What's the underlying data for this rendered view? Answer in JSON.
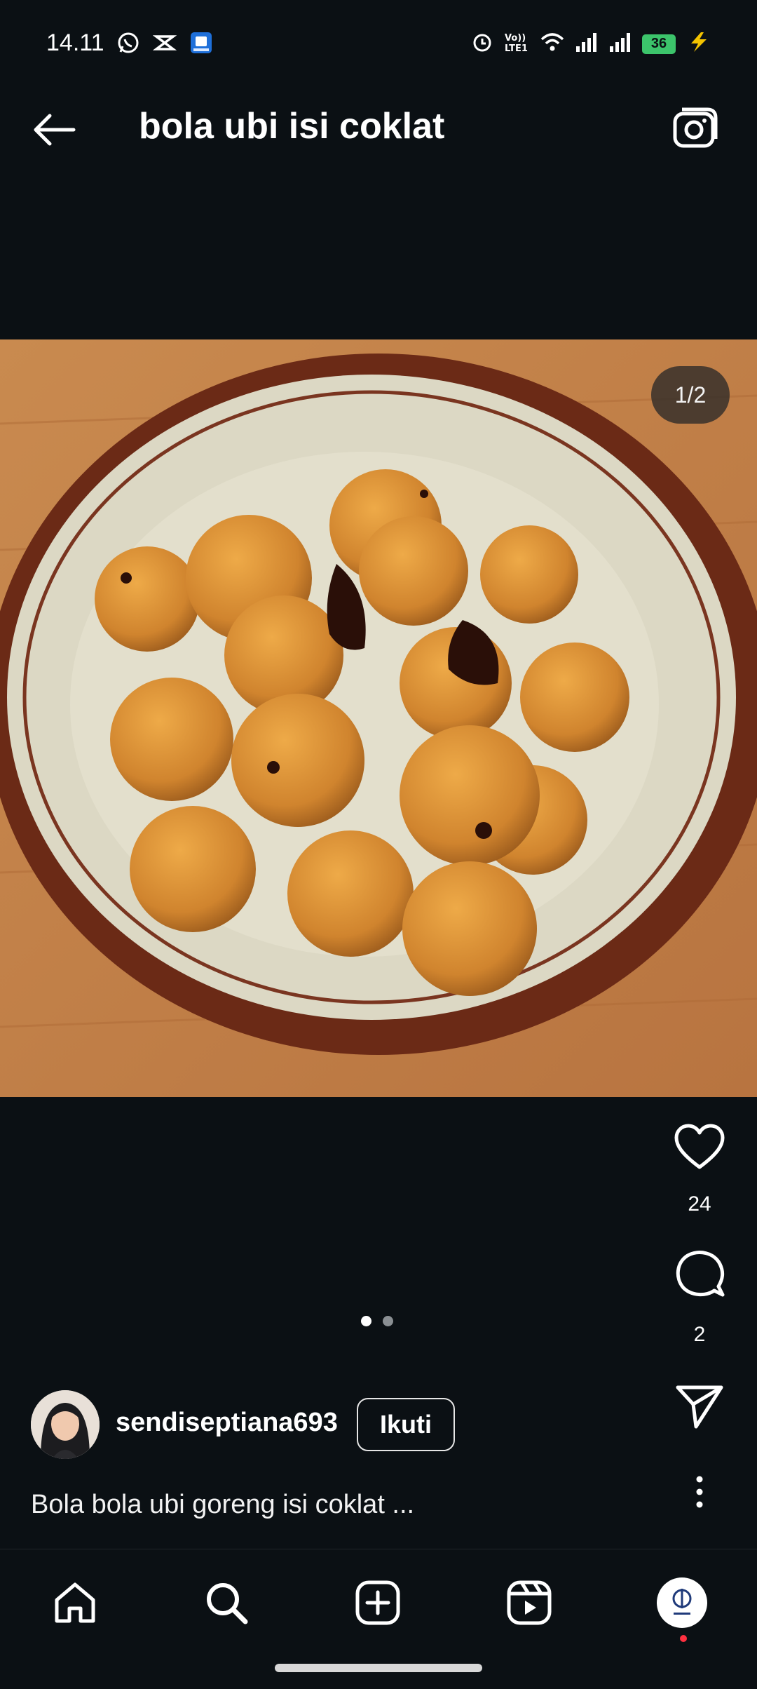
{
  "status_bar": {
    "time": "14.11",
    "left_icons": [
      "whatsapp-icon",
      "capcut-icon",
      "app-notification-icon"
    ],
    "right_icons": [
      "alarm-icon",
      "volte-icon",
      "wifi-icon",
      "signal-1-icon",
      "signal-2-icon"
    ],
    "battery": "36"
  },
  "header": {
    "title": "bola ubi isi coklat"
  },
  "post": {
    "page_counter": "1/2",
    "current_page": 1,
    "total_pages": 2,
    "likes": "24",
    "comments": "2"
  },
  "author": {
    "username": "sendiseptiana693",
    "follow_label": "Ikuti"
  },
  "caption": "Bola bola ubi goreng isi coklat ...",
  "bottom_nav": {
    "items": [
      "home-icon",
      "search-icon",
      "create-icon",
      "reels-icon",
      "profile-avatar"
    ]
  },
  "colors": {
    "background": "#0b1014",
    "text": "#ffffff",
    "notification_dot": "#ff3040"
  }
}
